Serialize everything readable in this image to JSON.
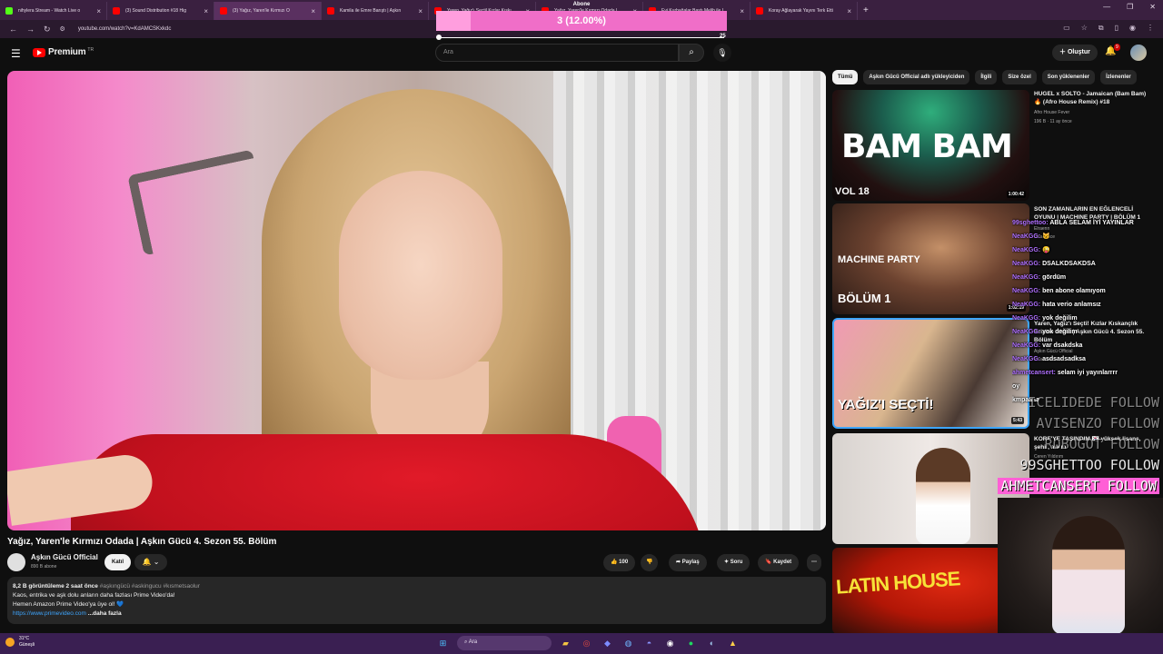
{
  "browser": {
    "tabs": [
      {
        "title": "nihylera Stream - Watch Live o",
        "favicon_color": "#53fc18",
        "active": false
      },
      {
        "title": "(3) Sound Distribution #18 Hig",
        "favicon_color": "#ff0000",
        "active": false
      },
      {
        "title": "(3) Yağız, Yaren'le Kırmızı O",
        "favicon_color": "#ff0000",
        "active": true
      },
      {
        "title": "Kamila ile Emre Barıştı | Aşkın",
        "favicon_color": "#ff0000",
        "active": false
      },
      {
        "title": "Yaren, Yağız'ı Seçtil Kızlar Kıskı",
        "favicon_color": "#ff0000",
        "active": false
      },
      {
        "title": "Yağız, Yaren'le Kırmızı Odada |",
        "favicon_color": "#ff0000",
        "active": false
      },
      {
        "title": "Evi Kurbağalar Bastı Melih ile I",
        "favicon_color": "#ff0000",
        "active": false
      },
      {
        "title": "Koray Ağlayarak Yayını Terk Etti",
        "favicon_color": "#ff0000",
        "active": false
      }
    ],
    "new_tab": "+",
    "url": "youtube.com/watch?v=KdAMCSKxkdc"
  },
  "overlay_goal": {
    "title": "Abone",
    "progress_text": "3 (12.00%)",
    "progress_fraction": 0.12,
    "min": "0",
    "max": "25"
  },
  "youtube": {
    "logo_text": "Premium",
    "logo_country": "TR",
    "search_placeholder": "Ara",
    "create_label": "Oluştur",
    "bell_badge": "9"
  },
  "video": {
    "title": "Yağız, Yaren'le Kırmızı Odada | Aşkın Gücü 4. Sezon 55. Bölüm",
    "channel": "Aşkın Gücü Official",
    "subscribers": "890 B abone",
    "join_label": "Katıl",
    "likes": "100",
    "share_label": "Paylaş",
    "ask_label": "Soru",
    "save_label": "Kaydet",
    "views_time": "8,2 B görüntüleme  2 saat önce",
    "hashtags": "#aşkıngücü #askingucu #kısmetsaolur",
    "desc_line1": "Kaos, entrika ve aşk dolu anların daha fazlası Prime Video'da!",
    "desc_line2": "Hemen Amazon Prime Video'ya üye ol! 💙",
    "desc_link": "https://www.primevideo.com",
    "more_label": "...daha fazla"
  },
  "chips": [
    "Tümü",
    "Aşkın Gücü Official adlı yükleyiciden",
    "İlgili",
    "Size özel",
    "Son yüklenenler",
    "İzlenenler"
  ],
  "recommendations": [
    {
      "title": "HUGEL x SOLTO - Jamaican (Bam Bam) 🔥 (Afro House Remix) #18",
      "channel": "Afro House Fever",
      "meta": "196 B · 11 ay önce",
      "duration": "1:00:42",
      "thumb_text": "BAM BAM",
      "thumb_sub": "VOL 18"
    },
    {
      "title": "SON ZAMANLARIN EN EĞLENCELİ OYUNU | MACHINE PARTY | BÖLÜM 1",
      "channel": "Elraenn",
      "meta": "3 sa. önce",
      "duration": "1:02:19",
      "thumb_text": "MACHINE PARTY",
      "thumb_sub": "BÖLÜM 1"
    },
    {
      "title": "Yaren, Yağız'ı Seçti! Kızlar Kıskançlık Krizine Girdi! | Aşkın Gücü 4. Sezon 55. Bölüm",
      "channel": "Aşkın Gücü Official",
      "meta": "1 sa. önce",
      "duration": "5:43",
      "thumb_text": "YAĞIZ'I SEÇTİ!"
    },
    {
      "title": "KORE'YE TAŞINDIM 🇰🇷 yüksek lisans, şehir, ailem",
      "channel": "Ceren Yıldırım",
      "meta": "",
      "duration": ""
    },
    {
      "title": "",
      "channel": "",
      "meta": "",
      "duration": "",
      "thumb_text": "LATIN HOUSE"
    }
  ],
  "chat": [
    {
      "user": "99sghettoo:",
      "msg": "ABLA SELAM İYİ YAYINLAR"
    },
    {
      "user": "NeaKGG:",
      "msg": "🐱"
    },
    {
      "user": "NeaKGG:",
      "msg": "😜"
    },
    {
      "user": "NeaKGG:",
      "msg": "DSALKDSAKDSA"
    },
    {
      "user": "NeaKGG:",
      "msg": "gördüm"
    },
    {
      "user": "NeaKGG:",
      "msg": "ben abone olamıyom"
    },
    {
      "user": "NeaKGG:",
      "msg": "hata verio anlamsız"
    },
    {
      "user": "NeaKGG:",
      "msg": "yok değilim"
    },
    {
      "user": "NeaKGG:",
      "msg": "yok değilim"
    },
    {
      "user": "NeaKGG:",
      "msg": "var dsakdska"
    },
    {
      "user": "NeaKGG:",
      "msg": "asdsadsadksa"
    },
    {
      "user": "ahmetcansert:",
      "msg": "selam iyi yayınlarrrr"
    },
    {
      "user": "",
      "msg": "oy"
    },
    {
      "user": "",
      "msg": "kmpaaaa"
    }
  ],
  "follows": [
    {
      "name": "ICELIDEDE FOLLOW",
      "style": "fade"
    },
    {
      "name": "AVISENZO FOLLOW",
      "style": "fade"
    },
    {
      "name": "ROBOGOT FOLLOW",
      "style": "fade"
    },
    {
      "name": "99SGHETTOO FOLLOW",
      "style": "normal"
    },
    {
      "name": "AHMETCANSERT FOLLOW",
      "style": "hl"
    }
  ],
  "taskbar": {
    "temp": "31°C",
    "weather": "Güneşli",
    "search_label": "Ara"
  },
  "colors": {
    "youtube_red": "#ff0000",
    "goal_pink": "#f06ec8",
    "chat_user": "#b070ff",
    "follow_highlight": "#ff5fd6",
    "link": "#3ea6ff",
    "taskbar": "#3a1f52"
  }
}
